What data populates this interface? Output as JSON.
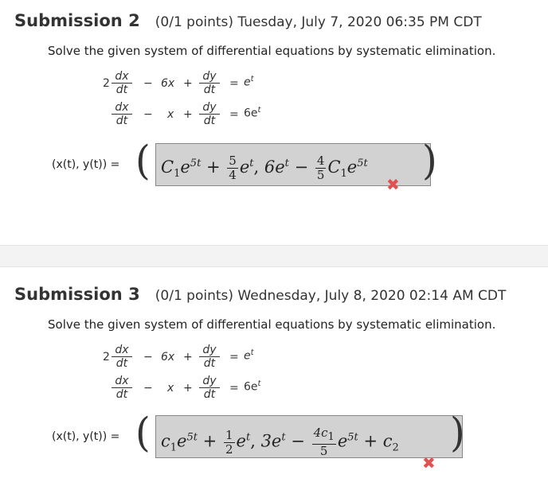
{
  "submissions": [
    {
      "title": "Submission 2",
      "meta": "(0/1 points) Tuesday, July 7, 2020 06:35 PM CDT",
      "problem": "Solve the given system of differential equations by systematic elimination.",
      "eq1": {
        "coef": "2",
        "frac_num": "dx",
        "frac_den": "dt",
        "op1": "−",
        "term": "6x",
        "op2": "+",
        "frac2_num": "dy",
        "frac2_den": "dt",
        "eq": "=",
        "rhs": "e",
        "rhs_exp": "t"
      },
      "eq2": {
        "frac_num": "dx",
        "frac_den": "dt",
        "op1": "−",
        "term": "x",
        "op2": "+",
        "frac2_num": "dy",
        "frac2_den": "dt",
        "eq": "=",
        "rhs": "6e",
        "rhs_exp": "t"
      },
      "answer_label": "(x(t), y(t)) =",
      "answer_parts": {
        "a": "C",
        "a_sub": "1",
        "a_e": "e",
        "a_exp": "5t",
        "plus": "+",
        "f1_n": "5",
        "f1_d": "4",
        "b": "e",
        "b_exp": "t",
        "comma": ",",
        "c": "6e",
        "c_exp": "t",
        "minus": "−",
        "f2_n": "4",
        "f2_d": "5",
        "d": "C",
        "d_sub": "1",
        "d_e": "e",
        "d_exp": "5t"
      },
      "status_icon": "✖"
    },
    {
      "title": "Submission 3",
      "meta": "(0/1 points) Wednesday, July 8, 2020 02:14 AM CDT",
      "problem": "Solve the given system of differential equations by systematic elimination.",
      "eq1": {
        "coef": "2",
        "frac_num": "dx",
        "frac_den": "dt",
        "op1": "−",
        "term": "6x",
        "op2": "+",
        "frac2_num": "dy",
        "frac2_den": "dt",
        "eq": "=",
        "rhs": "e",
        "rhs_exp": "t"
      },
      "eq2": {
        "frac_num": "dx",
        "frac_den": "dt",
        "op1": "−",
        "term": "x",
        "op2": "+",
        "frac2_num": "dy",
        "frac2_den": "dt",
        "eq": "=",
        "rhs": "6e",
        "rhs_exp": "t"
      },
      "answer_label": "(x(t), y(t)) =",
      "answer_parts": {
        "a": "c",
        "a_sub": "1",
        "a_e": "e",
        "a_exp": "5t",
        "plus": "+",
        "f1_n": "1",
        "f1_d": "2",
        "b": "e",
        "b_exp": "t",
        "comma": ",",
        "c": "3e",
        "c_exp": "t",
        "minus": "−",
        "f2_n": "4c",
        "f2_n_sub": "1",
        "f2_d": "5",
        "d_e": "e",
        "d_exp": "5t",
        "plus2": "+",
        "d2": "c",
        "d2_sub": "2"
      },
      "status_icon": "✖"
    }
  ],
  "colors": {
    "wrong": "#e05252",
    "answer_box": "#d2d2d2"
  },
  "icons": {
    "wrong": "x-mark-icon"
  }
}
